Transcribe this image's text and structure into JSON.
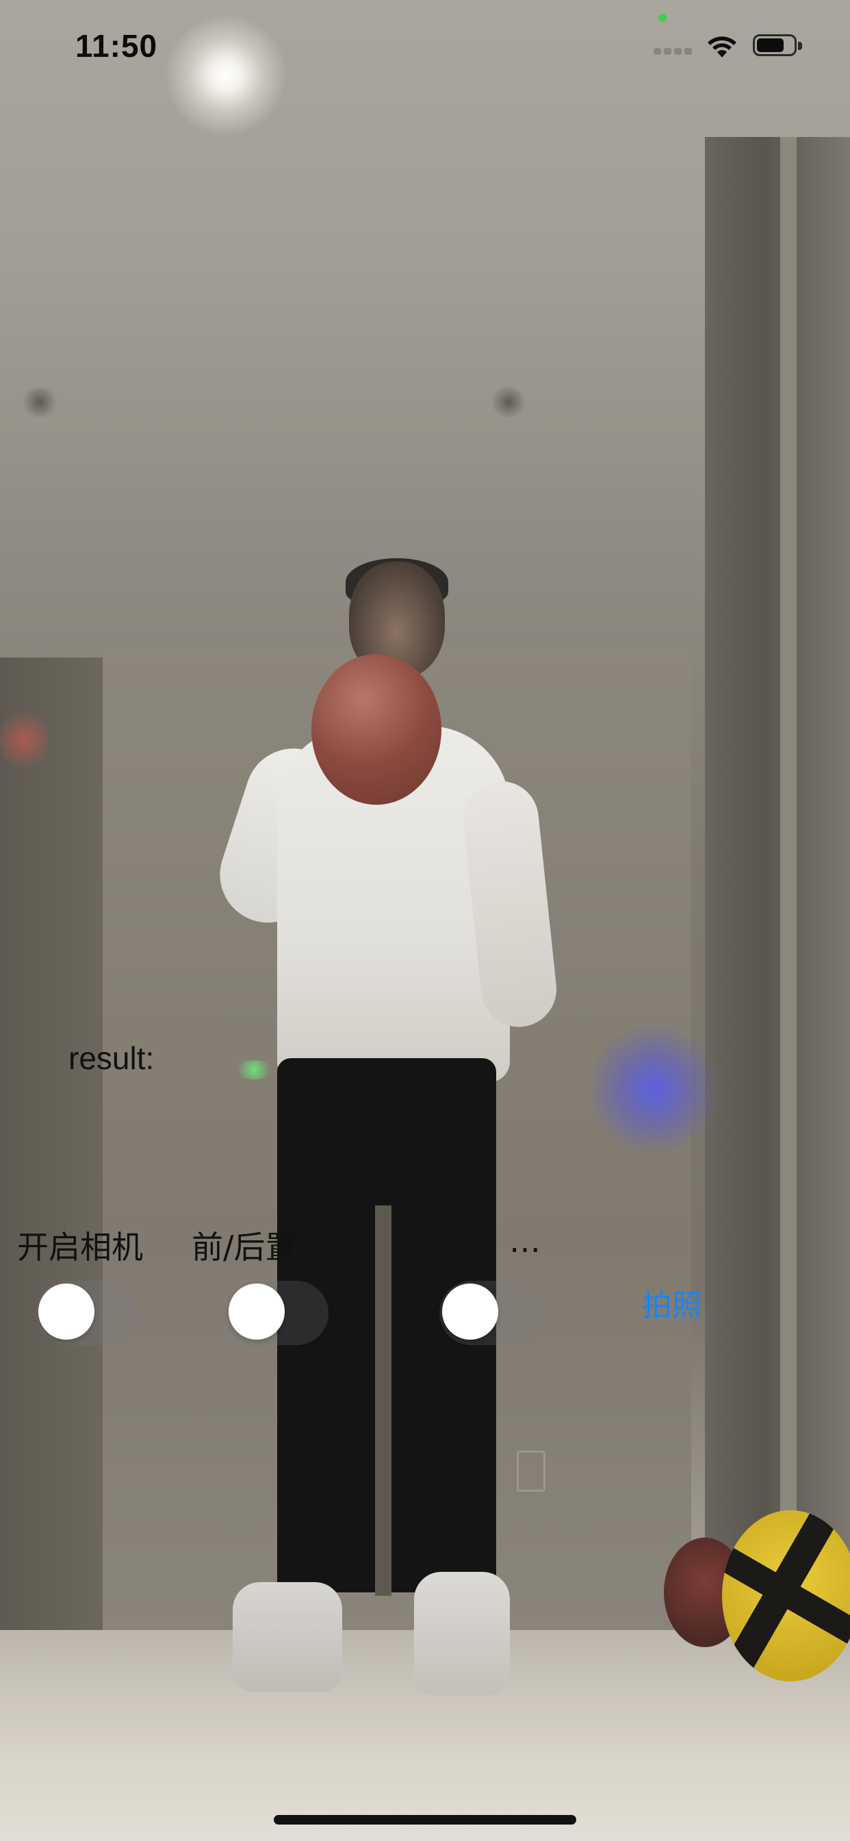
{
  "status_bar": {
    "time": "11:50",
    "icons": [
      "cell-signal-icon",
      "wifi-icon",
      "battery-icon"
    ],
    "battery_level": 0.75
  },
  "camera_preview": {
    "description_icon": "camera-feed"
  },
  "result": {
    "label": "result:"
  },
  "controls": {
    "camera_label": "开启相机",
    "flip_label": "前/后置",
    "third_label": "…",
    "camera_toggle_on": false,
    "flip_toggle_on": false,
    "third_toggle_on": false
  },
  "photo_button": {
    "label": "拍照",
    "color": "#1c84f2"
  }
}
